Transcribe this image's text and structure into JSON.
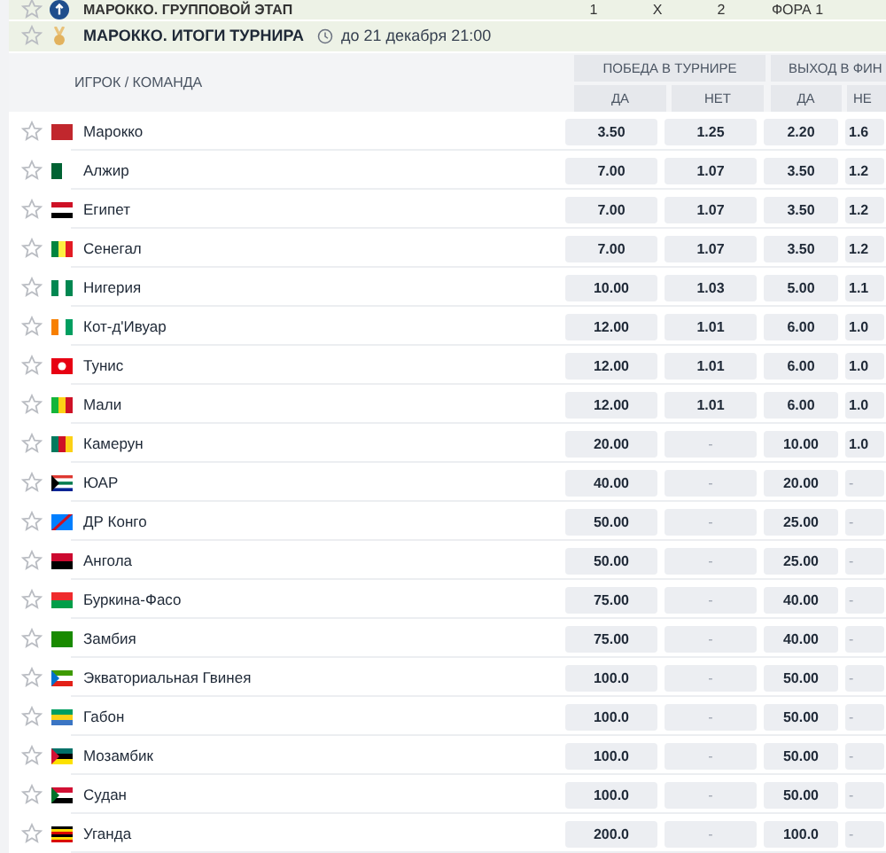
{
  "top_bar": {
    "title": "МАРОККО. ГРУППОВОЙ ЭТАП",
    "columns": [
      "1",
      "X",
      "2",
      "ФОРА 1"
    ]
  },
  "tournament": {
    "title": "МАРОККО. ИТОГИ ТУРНИРА",
    "time": "до 21 декабря 21:00"
  },
  "table": {
    "column_header": "ИГРОК / КОМАНДА",
    "groups": [
      {
        "label": "ПОБЕДА В ТУРНИРЕ",
        "subcolumns": [
          "ДА",
          "НЕТ"
        ]
      },
      {
        "label": "ВЫХОД В ФИН",
        "subcolumns": [
          "ДА",
          "НЕ"
        ]
      }
    ],
    "rows": [
      {
        "team": "Марокко",
        "odds": [
          "3.50",
          "1.25",
          "2.20",
          "1.6"
        ]
      },
      {
        "team": "Алжир",
        "odds": [
          "7.00",
          "1.07",
          "3.50",
          "1.2"
        ]
      },
      {
        "team": "Египет",
        "odds": [
          "7.00",
          "1.07",
          "3.50",
          "1.2"
        ]
      },
      {
        "team": "Сенегал",
        "odds": [
          "7.00",
          "1.07",
          "3.50",
          "1.2"
        ]
      },
      {
        "team": "Нигерия",
        "odds": [
          "10.00",
          "1.03",
          "5.00",
          "1.1"
        ]
      },
      {
        "team": "Кот-д'Ивуар",
        "odds": [
          "12.00",
          "1.01",
          "6.00",
          "1.0"
        ]
      },
      {
        "team": "Тунис",
        "odds": [
          "12.00",
          "1.01",
          "6.00",
          "1.0"
        ]
      },
      {
        "team": "Мали",
        "odds": [
          "12.00",
          "1.01",
          "6.00",
          "1.0"
        ]
      },
      {
        "team": "Камерун",
        "odds": [
          "20.00",
          "-",
          "10.00",
          "1.0"
        ]
      },
      {
        "team": "ЮАР",
        "odds": [
          "40.00",
          "-",
          "20.00",
          "-"
        ]
      },
      {
        "team": "ДР Конго",
        "odds": [
          "50.00",
          "-",
          "25.00",
          "-"
        ]
      },
      {
        "team": "Ангола",
        "odds": [
          "50.00",
          "-",
          "25.00",
          "-"
        ]
      },
      {
        "team": "Буркина-Фасо",
        "odds": [
          "75.00",
          "-",
          "40.00",
          "-"
        ]
      },
      {
        "team": "Замбия",
        "odds": [
          "75.00",
          "-",
          "40.00",
          "-"
        ]
      },
      {
        "team": "Экваториальная Гвинея",
        "odds": [
          "100.0",
          "-",
          "50.00",
          "-"
        ]
      },
      {
        "team": "Габон",
        "odds": [
          "100.0",
          "-",
          "50.00",
          "-"
        ]
      },
      {
        "team": "Мозамбик",
        "odds": [
          "100.0",
          "-",
          "50.00",
          "-"
        ]
      },
      {
        "team": "Судан",
        "odds": [
          "100.0",
          "-",
          "50.00",
          "-"
        ]
      },
      {
        "team": "Уганда",
        "odds": [
          "200.0",
          "-",
          "100.0",
          "-"
        ]
      }
    ]
  }
}
